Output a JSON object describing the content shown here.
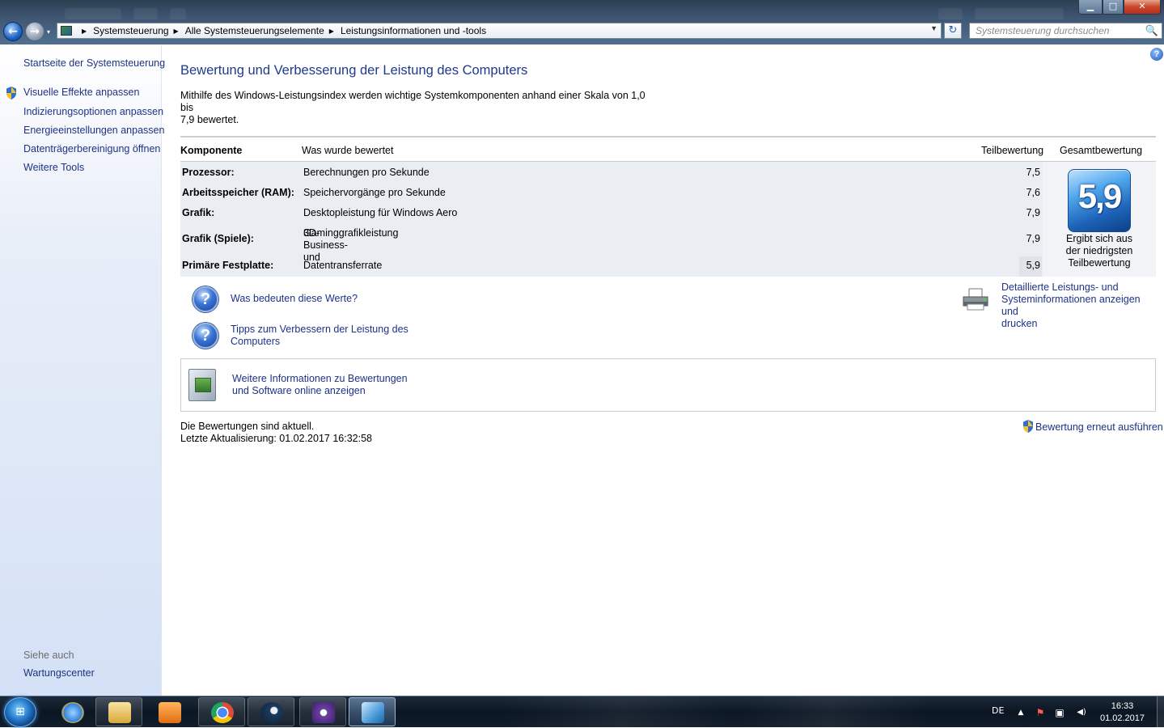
{
  "window": {
    "minimize": "▁",
    "maximize": "□",
    "close": "✕"
  },
  "nav": {
    "back_glyph": "←",
    "forward_glyph": "→",
    "dropdown_glyph": "▾"
  },
  "address": {
    "breadcrumbs": [
      "Systemsteuerung",
      "Alle Systemsteuerungselemente",
      "Leistungsinformationen und -tools"
    ],
    "separator": "▶",
    "dropdown_glyph": "▼",
    "refresh_glyph": "↻"
  },
  "search": {
    "placeholder": "Systemsteuerung durchsuchen",
    "icon": "🔍"
  },
  "sidebar": {
    "home": "Startseite der Systemsteuerung",
    "items": [
      {
        "label": "Visuelle Effekte anpassen",
        "shield": true
      },
      {
        "label": "Indizierungsoptionen anpassen",
        "shield": false
      },
      {
        "label": "Energieeinstellungen anpassen",
        "shield": false
      },
      {
        "label": "Datenträgerbereinigung öffnen",
        "shield": false
      },
      {
        "label": "Weitere Tools",
        "shield": false
      }
    ],
    "see_also": "Siehe auch",
    "see_also_items": [
      "Wartungscenter"
    ]
  },
  "main": {
    "help_glyph": "?",
    "title": "Bewertung und Verbesserung der Leistung des Computers",
    "intro_line1": "Mithilfe des Windows-Leistungsindex werden wichtige Systemkomponenten anhand einer Skala von 1,0 bis",
    "intro_line2": "7,9 bewertet.",
    "table": {
      "headers": {
        "component": "Komponente",
        "what": "Was wurde bewertet",
        "subscore": "Teilbewertung",
        "basescore": "Gesamtbewertung"
      },
      "rows": [
        {
          "component": "Prozessor:",
          "what": "Berechnungen pro Sekunde",
          "score": "7,5"
        },
        {
          "component": "Arbeitsspeicher (RAM):",
          "what": "Speichervorgänge pro Sekunde",
          "score": "7,6"
        },
        {
          "component": "Grafik:",
          "what": "Desktopleistung für Windows Aero",
          "score": "7,9"
        },
        {
          "component": "Grafik (Spiele):",
          "what": "3D-Business- und",
          "what2": "Gaminggrafikleistung",
          "score": "7,9"
        },
        {
          "component": "Primäre Festplatte:",
          "what": "Datentransferrate",
          "score": "5,9"
        }
      ],
      "base_score": "5,9",
      "base_caption": [
        "Ergibt sich aus",
        "der niedrigsten",
        "Teilbewertung"
      ]
    },
    "links": {
      "question_glyph": "?",
      "what_mean": "Was bedeuten diese Werte?",
      "tips_line1": "Tipps zum Verbessern der Leistung des",
      "tips_line2": "Computers",
      "details_line1": "Detaillierte Leistungs- und",
      "details_line2": "Systeminformationen anzeigen und",
      "details_line3": "drucken"
    },
    "info": {
      "line1": "Weitere Informationen zu Bewertungen",
      "line2": "und Software online anzeigen"
    },
    "status": {
      "line1": "Die Bewertungen sind aktuell.",
      "line2": "Letzte Aktualisierung: 01.02.2017 16:32:58",
      "rerun": "Bewertung erneut ausführen"
    }
  },
  "taskbar": {
    "start_glyph": "⊞",
    "apps": [
      {
        "name": "internet-explorer",
        "color": "#2f7fd9"
      },
      {
        "name": "explorer",
        "color": "#e7c35a"
      },
      {
        "name": "media-player",
        "color": "#f08a24"
      },
      {
        "name": "chrome",
        "color": "#dd4b39"
      },
      {
        "name": "steam",
        "color": "#1b3a5c"
      },
      {
        "name": "cpu-app",
        "color": "#6a3fa0"
      },
      {
        "name": "control-panel",
        "color": "#4a9bd8"
      }
    ],
    "language": "DE",
    "tray_up": "▲",
    "tray_flag": "⚑",
    "tray_network": "▣",
    "tray_volume": "◀)",
    "time": "16:33",
    "date": "01.02.2017"
  },
  "colors": {
    "link": "#1e3287",
    "title": "#1e3a8c",
    "table_bg": "#eaedf1"
  }
}
